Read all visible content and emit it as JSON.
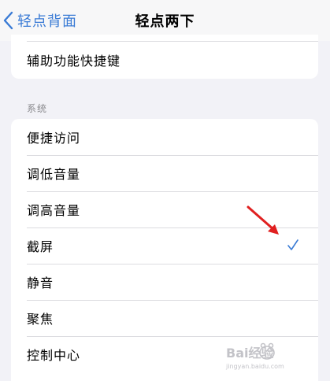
{
  "nav": {
    "back_label": "轻点背面",
    "title": "轻点两下"
  },
  "top_section": {
    "item": "辅助功能快捷键"
  },
  "system_section": {
    "header": "系统",
    "items": [
      {
        "label": "便捷访问"
      },
      {
        "label": "调低音量"
      },
      {
        "label": "调高音量"
      },
      {
        "label": "截屏",
        "selected": true
      },
      {
        "label": "静音"
      },
      {
        "label": "聚焦"
      },
      {
        "label": "控制中心"
      }
    ]
  },
  "icons": {
    "back": "chevron-left-icon",
    "check": "checkmark-icon",
    "annotation": "red-arrow-icon"
  },
  "colors": {
    "accent": "#3a7bd5",
    "background": "#f2f2f7",
    "card": "#ffffff",
    "annotation": "#e02020"
  },
  "watermark": {
    "text": "Bai经验",
    "url": "jingyan.baidu.com"
  }
}
